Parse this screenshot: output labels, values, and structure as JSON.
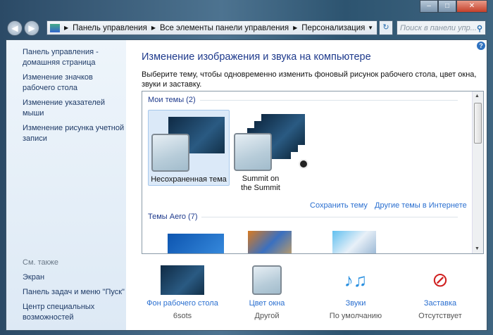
{
  "window": {
    "minimize": "–",
    "maximize": "□",
    "close": "✕"
  },
  "breadcrumb": [
    "Панель управления",
    "Все элементы панели управления",
    "Персонализация"
  ],
  "search": {
    "placeholder": "Поиск в панели упр..."
  },
  "sidebar": {
    "items": [
      "Панель управления - домашняя страница",
      "Изменение значков рабочего стола",
      "Изменение указателей мыши",
      "Изменение рисунка учетной записи"
    ],
    "see_also": "См. также",
    "see_also_items": [
      "Экран",
      "Панель задач и меню \"Пуск\"",
      "Центр специальных возможностей"
    ]
  },
  "main": {
    "title": "Изменение изображения и звука на компьютере",
    "description": "Выберите тему, чтобы одновременно изменить фоновый рисунок рабочего стола, цвет окна, звуки и заставку.",
    "my_themes": {
      "label": "Мои темы (2)",
      "items": [
        "Несохраненная тема",
        "Summit on the Summit"
      ]
    },
    "save_theme": "Сохранить тему",
    "more_themes": "Другие темы в Интернете",
    "aero_themes": {
      "label": "Темы Aero (7)"
    }
  },
  "bottom": [
    {
      "label": "Фон рабочего стола",
      "value": "6sots"
    },
    {
      "label": "Цвет окна",
      "value": "Другой"
    },
    {
      "label": "Звуки",
      "value": "По умолчанию"
    },
    {
      "label": "Заставка",
      "value": "Отсутствует"
    }
  ]
}
